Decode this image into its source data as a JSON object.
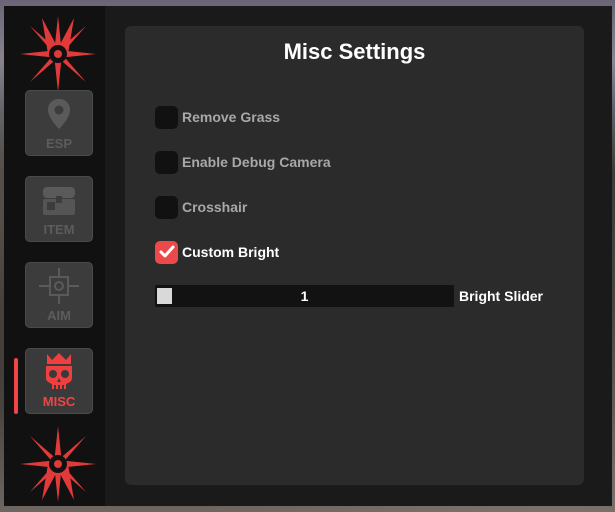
{
  "sidebar": {
    "tabs": [
      {
        "id": "esp",
        "label": "ESP",
        "icon": "map-pin-icon",
        "active": false
      },
      {
        "id": "item",
        "label": "ITEM",
        "icon": "chest-icon",
        "active": false
      },
      {
        "id": "aim",
        "label": "AIM",
        "icon": "crosshair-target-icon",
        "active": false
      },
      {
        "id": "misc",
        "label": "MISC",
        "icon": "crowned-skull-icon",
        "active": true
      }
    ],
    "logo_icon": "spiked-burst-logo-icon"
  },
  "panel": {
    "title": "Misc Settings",
    "options": [
      {
        "label": "Remove Grass",
        "checked": false
      },
      {
        "label": "Enable Debug Camera",
        "checked": false
      },
      {
        "label": "Crosshair",
        "checked": false
      },
      {
        "label": "Custom Bright",
        "checked": true
      }
    ],
    "slider": {
      "label": "Bright Slider",
      "value": "1"
    }
  },
  "colors": {
    "accent": "#ec4a4a",
    "panel_bg": "#2b2b2b",
    "sidebar_bg": "#111111"
  }
}
